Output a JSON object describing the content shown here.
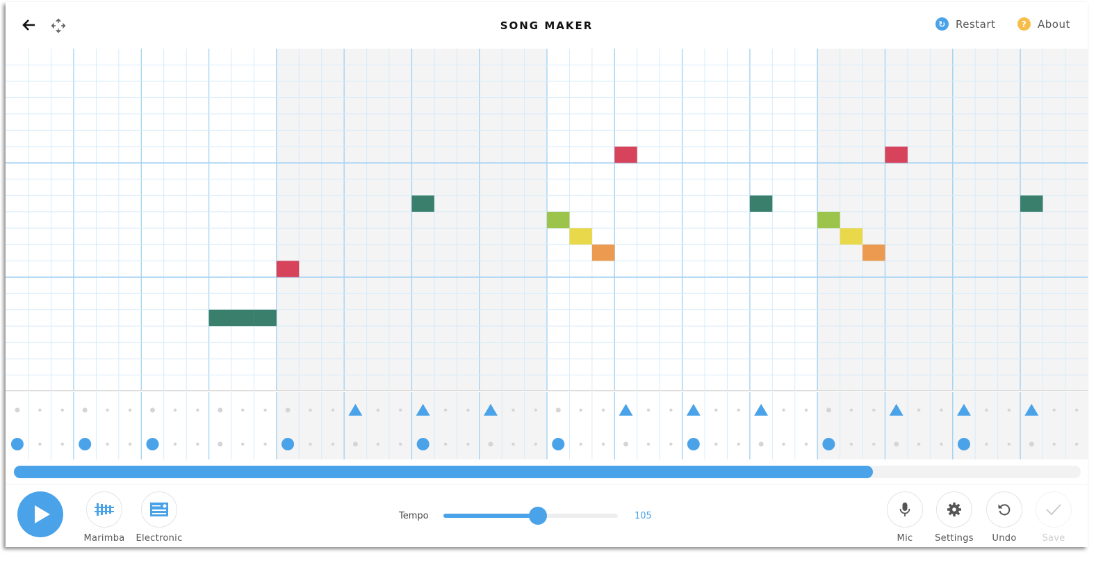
{
  "header": {
    "title": "SONG MAKER",
    "restart_label": "Restart",
    "about_label": "About",
    "back_icon": "arrow-left-icon",
    "move_icon": "move-arrows-icon"
  },
  "colors": {
    "accent": "#4aa3e8",
    "restart": "#4aa3e8",
    "about": "#f6bd4a",
    "shade": "#f4f4f4",
    "grid_line": "#d6ebfa",
    "bar_line": "#9fd0f2"
  },
  "grid": {
    "rows": 21,
    "columns": 48,
    "steps_per_beat": 3,
    "beats_per_bar": 4,
    "bars": 4,
    "notes": [
      {
        "col": 9,
        "row": 16,
        "color": "#3a7f6b"
      },
      {
        "col": 10,
        "row": 16,
        "color": "#3a7f6b"
      },
      {
        "col": 11,
        "row": 16,
        "color": "#3a7f6b"
      },
      {
        "col": 12,
        "row": 13,
        "color": "#d6435a"
      },
      {
        "col": 18,
        "row": 9,
        "color": "#3a7f6b"
      },
      {
        "col": 24,
        "row": 10,
        "color": "#9dc44a"
      },
      {
        "col": 25,
        "row": 11,
        "color": "#e8d84a"
      },
      {
        "col": 26,
        "row": 12,
        "color": "#ec9a50"
      },
      {
        "col": 27,
        "row": 6,
        "color": "#d6435a"
      },
      {
        "col": 33,
        "row": 9,
        "color": "#3a7f6b"
      },
      {
        "col": 36,
        "row": 10,
        "color": "#9dc44a"
      },
      {
        "col": 37,
        "row": 11,
        "color": "#e8d84a"
      },
      {
        "col": 38,
        "row": 12,
        "color": "#ec9a50"
      },
      {
        "col": 39,
        "row": 6,
        "color": "#d6435a"
      },
      {
        "col": 45,
        "row": 9,
        "color": "#3a7f6b"
      }
    ]
  },
  "percussion": {
    "triangles": [
      15,
      18,
      21,
      27,
      30,
      33,
      39,
      42,
      45
    ],
    "circles": [
      0,
      3,
      6,
      12,
      18,
      24,
      30,
      36,
      42
    ]
  },
  "progress": {
    "value": 0.805
  },
  "controls": {
    "play_label": "Play",
    "instrument_label": "Marimba",
    "instrument_icon": "marimba-icon",
    "drum_label": "Electronic",
    "drum_icon": "drum-machine-icon",
    "tempo_label": "Tempo",
    "tempo_value": "105",
    "tempo_fraction": 0.54,
    "mic_label": "Mic",
    "settings_label": "Settings",
    "undo_label": "Undo",
    "save_label": "Save"
  }
}
